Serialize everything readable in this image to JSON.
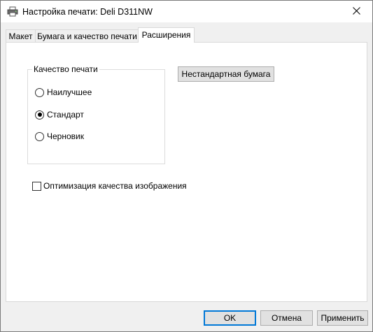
{
  "window": {
    "title": "Настройка печати: Deli D311NW"
  },
  "tabs": [
    {
      "label": "Макет",
      "active": false
    },
    {
      "label": "Бумага и качество печати",
      "active": false
    },
    {
      "label": "Расширения",
      "active": true
    }
  ],
  "print_quality": {
    "label": "Качество печати",
    "options": [
      {
        "label": "Наилучшее",
        "selected": false
      },
      {
        "label": "Стандарт",
        "selected": true
      },
      {
        "label": "Черновик",
        "selected": false
      }
    ]
  },
  "custom_paper_button": "Нестандартная бумага",
  "image_optimization": {
    "label": "Оптимизация качества изображения",
    "checked": false
  },
  "footer": {
    "ok": "OK",
    "cancel": "Отмена",
    "apply": "Применить"
  }
}
